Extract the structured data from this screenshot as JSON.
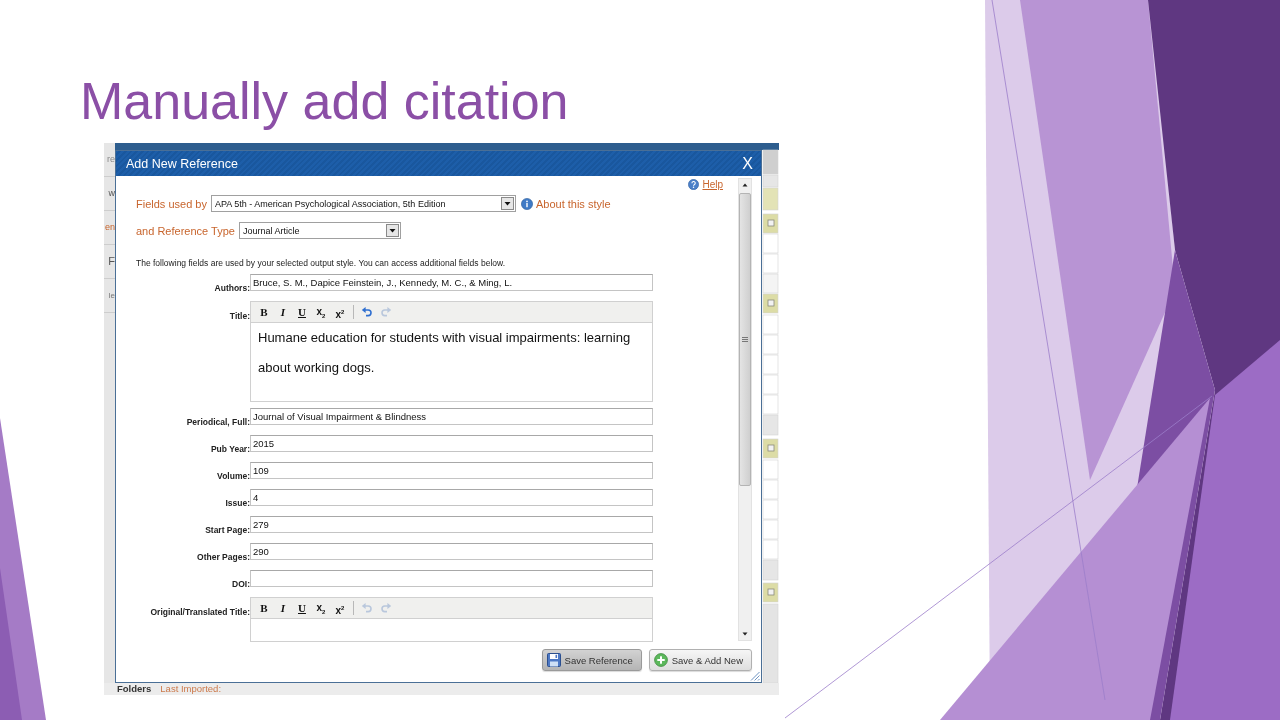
{
  "slide": {
    "title": "Manually add citation"
  },
  "background_app": {
    "side_fragments": [
      {
        "kind": "tab",
        "text": "re"
      },
      {
        "kind": "button",
        "text": "w"
      },
      {
        "kind": "link",
        "text": "en"
      },
      {
        "kind": "heading",
        "text": "F"
      },
      {
        "kind": "label",
        "text": "le"
      }
    ],
    "footer": [
      {
        "kind": "heading",
        "text": "Folders"
      },
      {
        "kind": "link",
        "text": "Last Imported:"
      }
    ]
  },
  "dialog": {
    "title": "Add New Reference",
    "close": "X",
    "help": "Help",
    "style_field": {
      "label": "Fields used by",
      "value": "APA 5th - American Psychological Association, 5th Edition",
      "info_link": "About this style"
    },
    "type_field": {
      "label": "and Reference Type",
      "value": "Journal Article"
    },
    "note": "The following fields are used by your selected output style. You can access additional fields below.",
    "fields": [
      {
        "kind": "text",
        "label": "Authors:",
        "value": "Bruce, S. M., Dapice Feinstein, J., Kennedy, M. C., & Ming, L."
      },
      {
        "kind": "editor",
        "label": "Title:",
        "toolbar": [
          {
            "kind": "bold",
            "label": "B",
            "disabled": false
          },
          {
            "kind": "italic",
            "label": "I",
            "disabled": false
          },
          {
            "kind": "underline",
            "label": "U",
            "disabled": false
          },
          {
            "kind": "subscript",
            "label": "x$_{2}$",
            "disabled": false
          },
          {
            "kind": "superscript",
            "label": "x$^{2}$",
            "disabled": false
          },
          {
            "kind": "undo",
            "disabled": false
          },
          {
            "kind": "redo",
            "disabled": true
          }
        ],
        "value": "Humane education for students with visual impairments: learning about working dogs."
      },
      {
        "kind": "text",
        "label": "Periodical, Full:",
        "value": "Journal of Visual Impairment & Blindness"
      },
      {
        "kind": "text",
        "label": "Pub Year:",
        "value": "2015"
      },
      {
        "kind": "text",
        "label": "Volume:",
        "value": "109"
      },
      {
        "kind": "text",
        "label": "Issue:",
        "value": "4"
      },
      {
        "kind": "text",
        "label": "Start Page:",
        "value": "279"
      },
      {
        "kind": "text",
        "label": "Other Pages:",
        "value": "290"
      },
      {
        "kind": "text",
        "label": "DOI:"
      },
      {
        "kind": "editor",
        "label": "Original/Translated Title:",
        "toolbar": [
          {
            "kind": "bold",
            "label": "B",
            "disabled": false
          },
          {
            "kind": "italic",
            "label": "I",
            "disabled": false
          },
          {
            "kind": "underline",
            "label": "U",
            "disabled": false
          },
          {
            "kind": "subscript",
            "label": "x$_{2}$",
            "disabled": false
          },
          {
            "kind": "superscript",
            "label": "x$^{2}$",
            "disabled": false
          },
          {
            "kind": "undo",
            "disabled": true
          },
          {
            "kind": "redo",
            "disabled": true
          }
        ]
      }
    ],
    "buttons": [
      {
        "kind": "save",
        "label": "Save Reference",
        "highlighted": true
      },
      {
        "kind": "save_new",
        "label": "Save & Add New",
        "highlighted": false
      }
    ]
  }
}
